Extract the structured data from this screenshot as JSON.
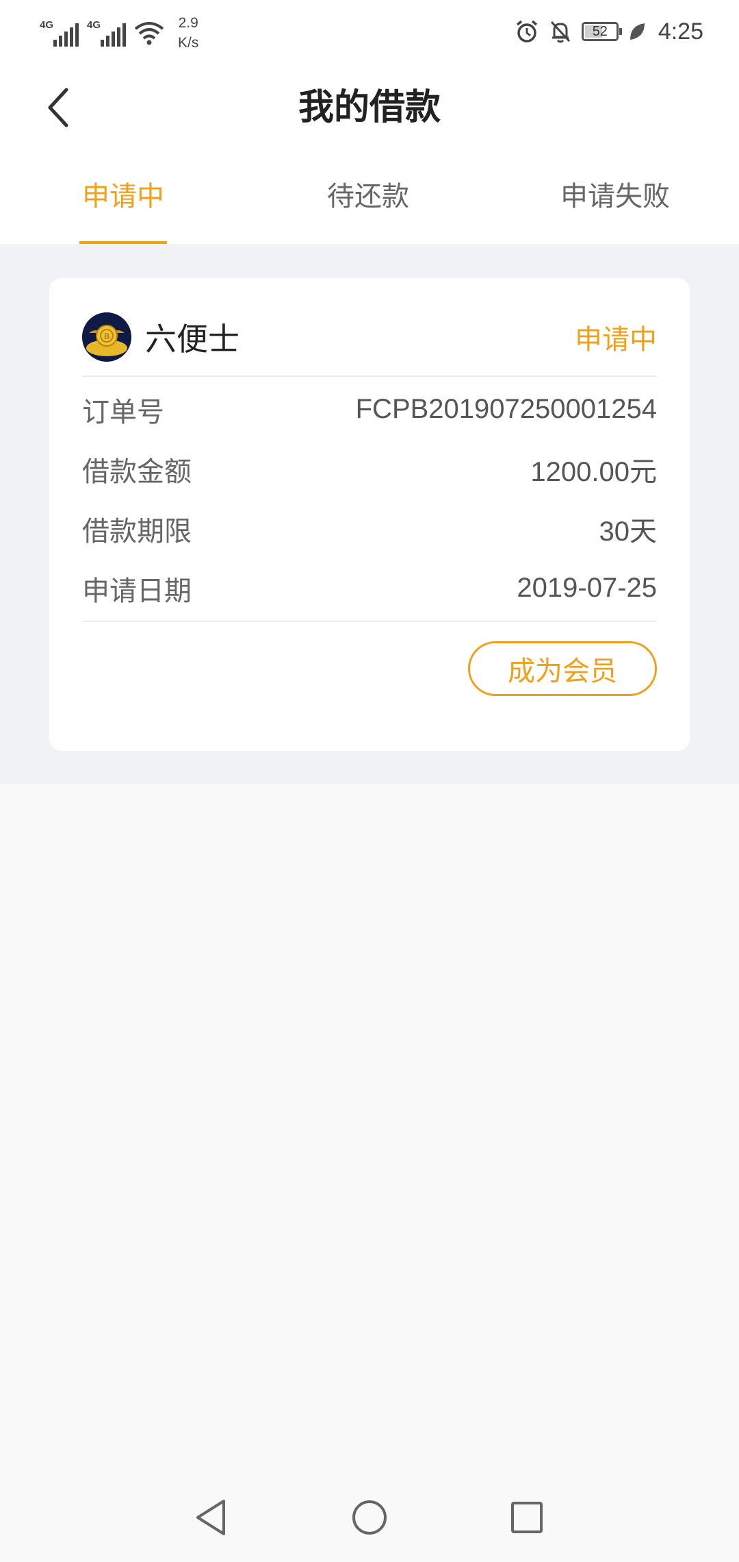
{
  "status_bar": {
    "network_1": "4G",
    "network_2": "4G",
    "speed_value": "2.9",
    "speed_unit": "K/s",
    "battery_level": "52",
    "time": "4:25"
  },
  "header": {
    "title": "我的借款"
  },
  "tabs": [
    {
      "label": "申请中",
      "active": true
    },
    {
      "label": "待还款",
      "active": false
    },
    {
      "label": "申请失败",
      "active": false
    }
  ],
  "loan_card": {
    "lender_name": "六便士",
    "status": "申请中",
    "rows": [
      {
        "label": "订单号",
        "value": "FCPB201907250001254"
      },
      {
        "label": "借款金额",
        "value": "1200.00元"
      },
      {
        "label": "借款期限",
        "value": "30天"
      },
      {
        "label": "申请日期",
        "value": "2019-07-25"
      }
    ],
    "action_label": "成为会员"
  },
  "colors": {
    "accent": "#f0a11c",
    "title": "#222222",
    "label": "#666666",
    "band_bg": "#f0f2f5"
  },
  "icons": {
    "back": "chevron-left-icon",
    "alarm": "alarm-icon",
    "mute": "bell-off-icon",
    "leaf": "leaf-icon",
    "nav_back": "triangle-back-icon",
    "nav_home": "circle-home-icon",
    "nav_recent": "square-recent-icon"
  }
}
